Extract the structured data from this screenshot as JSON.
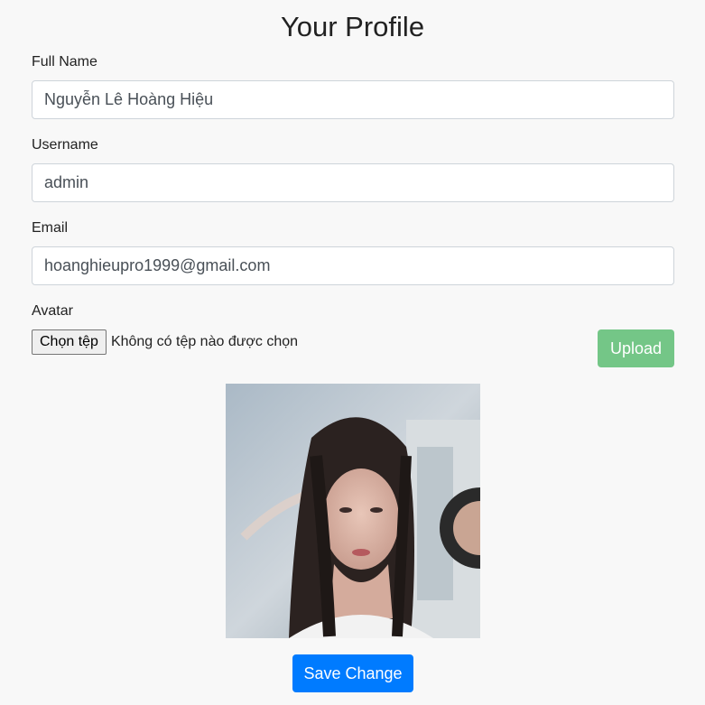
{
  "page": {
    "title": "Your Profile"
  },
  "form": {
    "full_name": {
      "label": "Full Name",
      "value": "Nguyễn Lê Hoàng Hiệu"
    },
    "username": {
      "label": "Username",
      "value": "admin"
    },
    "email": {
      "label": "Email",
      "value": "hoanghieupro1999@gmail.com"
    },
    "avatar": {
      "label": "Avatar",
      "choose_file_label": "Chọn tệp",
      "file_status": "Không có tệp nào được chọn",
      "upload_label": "Upload"
    },
    "save_label": "Save Change"
  },
  "colors": {
    "upload_button": "#74c687",
    "save_button": "#007bff",
    "background": "#f8f8f8"
  }
}
